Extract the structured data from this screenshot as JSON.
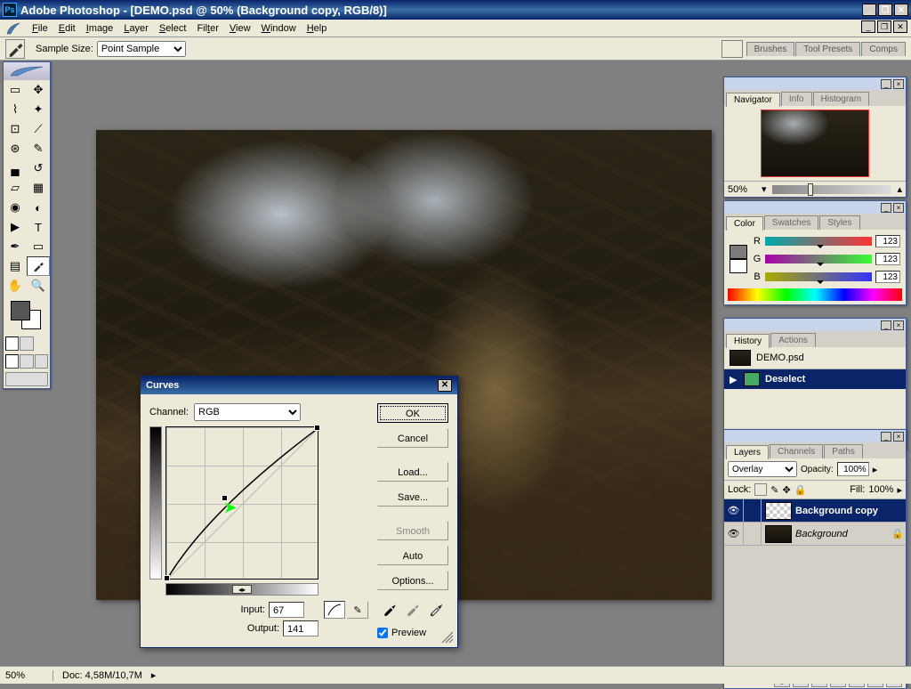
{
  "title": "Adobe Photoshop - [DEMO.psd @ 50% (Background copy, RGB/8)]",
  "menu": [
    "File",
    "Edit",
    "Image",
    "Layer",
    "Select",
    "Filter",
    "View",
    "Window",
    "Help"
  ],
  "optbar": {
    "label": "Sample Size:",
    "value": "Point Sample"
  },
  "well_tabs": [
    "Brushes",
    "Tool Presets",
    "Comps"
  ],
  "status": {
    "zoom": "50%",
    "doc": "Doc: 4,58M/10,7M"
  },
  "navigator": {
    "tabs": [
      "Navigator",
      "Info",
      "Histogram"
    ],
    "zoom": "50%"
  },
  "color": {
    "tabs": [
      "Color",
      "Swatches",
      "Styles"
    ],
    "r": "123",
    "g": "123",
    "b": "123"
  },
  "history": {
    "tabs": [
      "History",
      "Actions"
    ],
    "doc": "DEMO.psd",
    "state": "Deselect"
  },
  "layers": {
    "tabs": [
      "Layers",
      "Channels",
      "Paths"
    ],
    "blend": "Overlay",
    "opacity_label": "Opacity:",
    "opacity": "100%",
    "lock_label": "Lock:",
    "fill_label": "Fill:",
    "fill": "100%",
    "rows": [
      {
        "name": "Background copy",
        "sel": true,
        "italic": false,
        "locked": false
      },
      {
        "name": "Background",
        "sel": false,
        "italic": true,
        "locked": true
      }
    ]
  },
  "curves": {
    "title": "Curves",
    "channel_label": "Channel:",
    "channel": "RGB",
    "input_label": "Input:",
    "input": "67",
    "output_label": "Output:",
    "output": "141",
    "buttons": [
      "OK",
      "Cancel",
      "Load...",
      "Save...",
      "Smooth",
      "Auto",
      "Options..."
    ],
    "preview_label": "Preview"
  }
}
